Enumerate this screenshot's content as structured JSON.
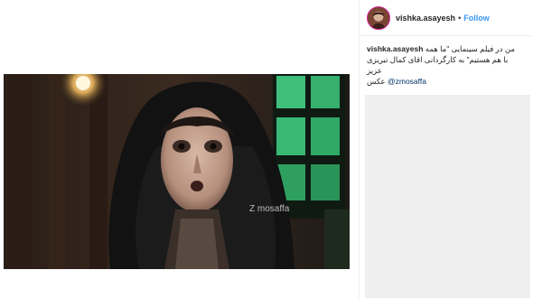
{
  "post": {
    "watermark": "Z mosaffa"
  },
  "header": {
    "username": "vishka.asayesh",
    "separator": "•",
    "follow_label": "Follow",
    "avatar_icon": "profile-avatar-icon"
  },
  "caption": {
    "username": "vishka.asayesh",
    "line1": "من در فیلم سینمایی \"ما همه",
    "line2": "با هم هستیم\" به کارگردانی اقای کمال تبریزی",
    "line3": "عزیز",
    "credit_word": "عکس",
    "mention": "@zmosaffa"
  },
  "colors": {
    "accent": "#3897f0",
    "mention": "#003569",
    "panel": "#efefef"
  }
}
